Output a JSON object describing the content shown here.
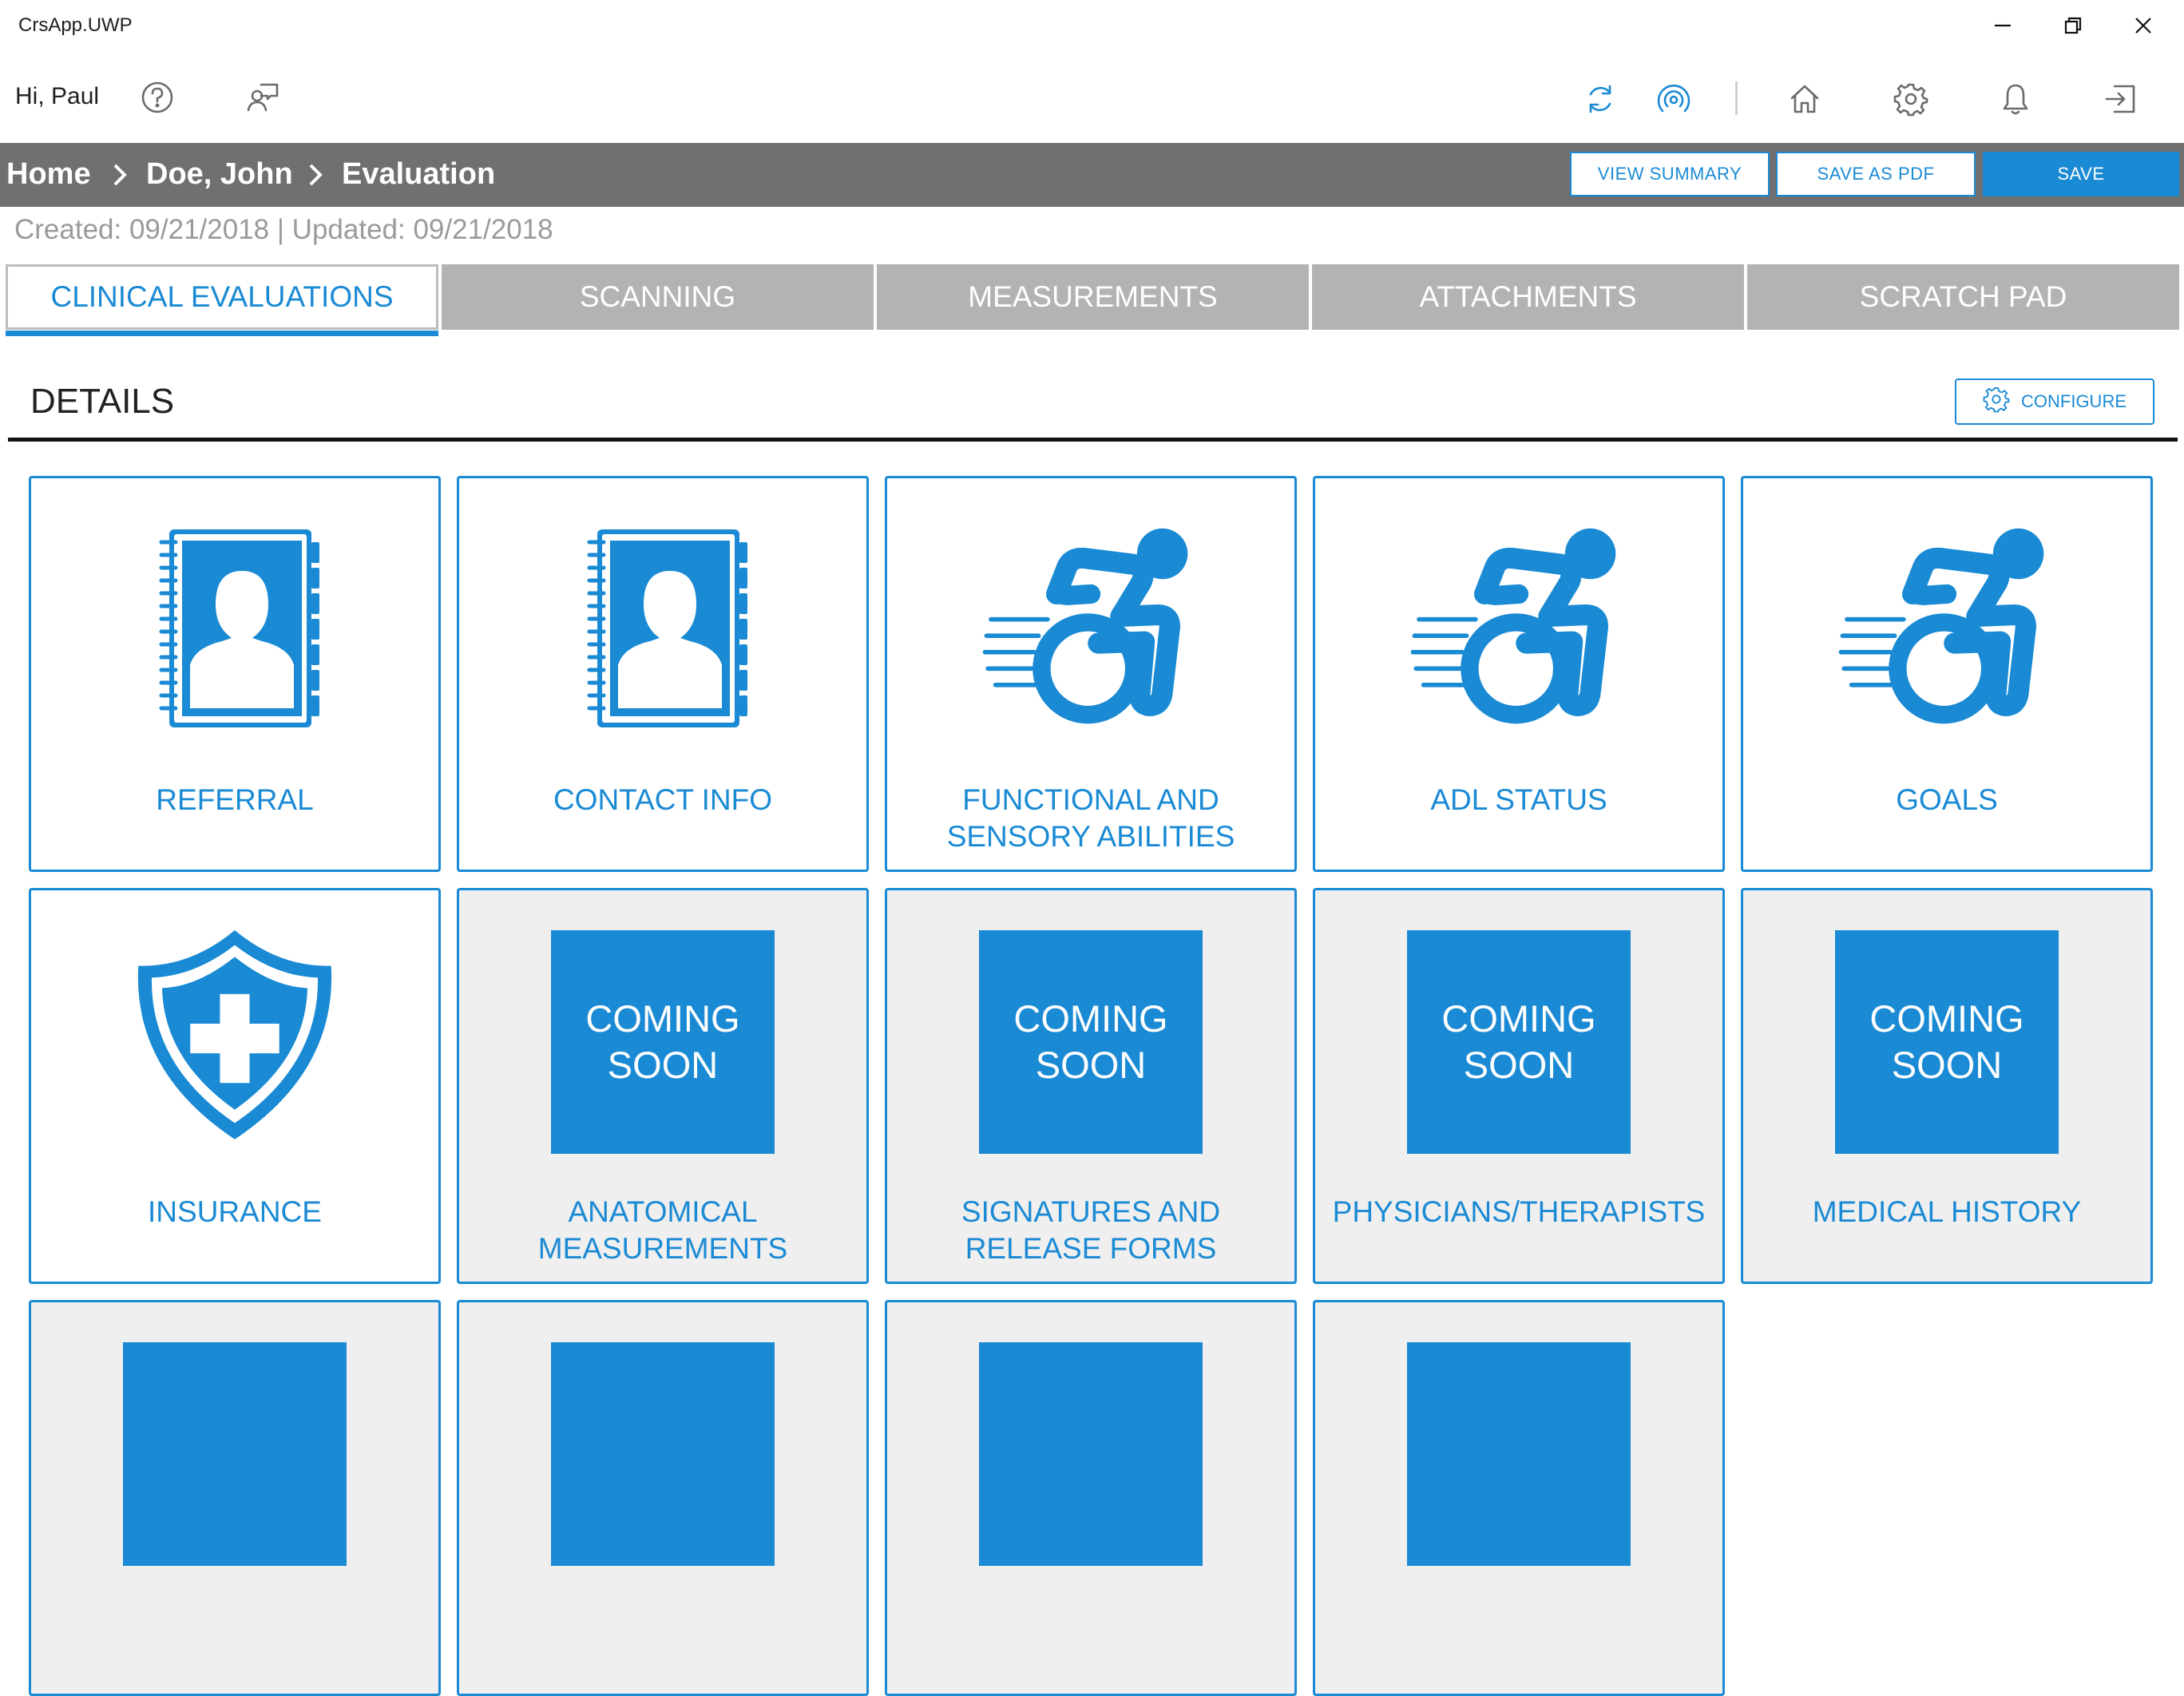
{
  "window": {
    "title": "CrsApp.UWP"
  },
  "header": {
    "greeting": "Hi, Paul"
  },
  "breadcrumb": {
    "home": "Home",
    "patient": "Doe, John",
    "page": "Evaluation"
  },
  "actions": {
    "view_summary": "VIEW SUMMARY",
    "save_pdf": "SAVE AS PDF",
    "save": "SAVE"
  },
  "dates": "Created: 09/21/2018 | Updated: 09/21/2018",
  "tabs": [
    {
      "label": "CLINICAL EVALUATIONS",
      "active": true
    },
    {
      "label": "SCANNING"
    },
    {
      "label": "MEASUREMENTS"
    },
    {
      "label": "ATTACHMENTS"
    },
    {
      "label": "SCRATCH PAD"
    }
  ],
  "details": {
    "title": "DETAILS",
    "configure": "CONFIGURE"
  },
  "tiles": [
    {
      "label": "REFERRAL",
      "icon": "contact-book-icon"
    },
    {
      "label": "CONTACT INFO",
      "icon": "contact-book-icon"
    },
    {
      "label": "FUNCTIONAL AND SENSORY ABILITIES",
      "icon": "wheelchair-icon"
    },
    {
      "label": "ADL STATUS",
      "icon": "wheelchair-icon"
    },
    {
      "label": "GOALS",
      "icon": "wheelchair-icon"
    },
    {
      "label": "INSURANCE",
      "icon": "shield-cross-icon"
    },
    {
      "label": "ANATOMICAL MEASUREMENTS",
      "soon_line1": "COMING",
      "soon_line2": "SOON"
    },
    {
      "label": "SIGNATURES AND RELEASE FORMS",
      "soon_line1": "COMING",
      "soon_line2": "SOON"
    },
    {
      "label": "PHYSICIANS/THERAPISTS",
      "soon_line1": "COMING",
      "soon_line2": "SOON"
    },
    {
      "label": "MEDICAL HISTORY",
      "soon_line1": "COMING",
      "soon_line2": "SOON"
    }
  ],
  "colors": {
    "accent": "#1a8ad4",
    "bar": "#707070",
    "tab_inactive": "#b3b3b3",
    "soon_bg": "#efefef"
  }
}
